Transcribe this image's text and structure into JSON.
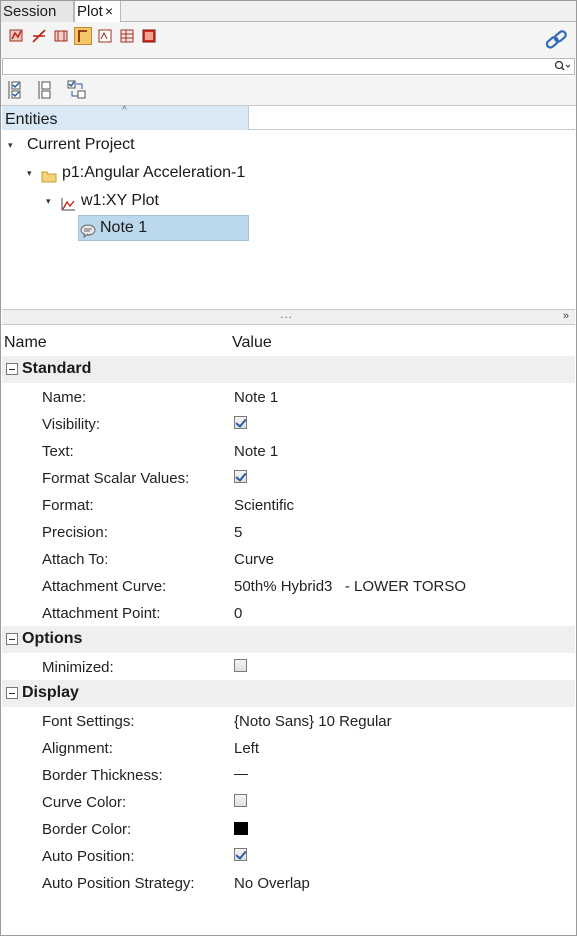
{
  "tabs": [
    {
      "label": "Session"
    },
    {
      "label": "Plot",
      "close": "×"
    }
  ],
  "search": {
    "value": "",
    "placeholder": ""
  },
  "tree": {
    "column_header": "Entities",
    "items": [
      {
        "label": "Current Project",
        "level": 0,
        "icon": "none"
      },
      {
        "label": "p1:Angular Acceleration-1",
        "level": 1,
        "icon": "folder-icon"
      },
      {
        "label": "w1:XY Plot",
        "level": 2,
        "icon": "xy-plot-icon"
      },
      {
        "label": "Note 1",
        "level": 3,
        "icon": "note-icon",
        "selected": true
      }
    ]
  },
  "splitter": {
    "dots": "...",
    "chevron": "»"
  },
  "properties": {
    "col_name": "Name",
    "col_value": "Value",
    "groups": {
      "standard": {
        "label": "Standard",
        "rows": {
          "name": {
            "label": "Name:",
            "value": "Note 1"
          },
          "visibility": {
            "label": "Visibility:",
            "checked": true
          },
          "text": {
            "label": "Text:",
            "value": "Note 1"
          },
          "format_scalar": {
            "label": "Format Scalar Values:",
            "checked": true
          },
          "format": {
            "label": "Format:",
            "value": "Scientific"
          },
          "precision": {
            "label": "Precision:",
            "value": "5"
          },
          "attach_to": {
            "label": "Attach To:",
            "value": "Curve"
          },
          "attachment_curve": {
            "label": "Attachment Curve:",
            "value": "50th% Hybrid3   - LOWER TORSO"
          },
          "attachment_point": {
            "label": "Attachment Point:",
            "value": "0"
          }
        }
      },
      "options": {
        "label": "Options",
        "rows": {
          "minimized": {
            "label": "Minimized:",
            "checked": false
          }
        }
      },
      "display": {
        "label": "Display",
        "rows": {
          "font_settings": {
            "label": "Font Settings:",
            "value": "{Noto Sans} 10 Regular"
          },
          "alignment": {
            "label": "Alignment:",
            "value": "Left"
          },
          "border_thickness": {
            "label": "Border Thickness:",
            "value": "line"
          },
          "curve_color": {
            "label": "Curve Color:",
            "checked": false
          },
          "border_color": {
            "label": "Border Color:",
            "color": "#000000"
          },
          "auto_position": {
            "label": "Auto Position:",
            "checked": true
          },
          "auto_position_strategy": {
            "label": "Auto Position Strategy:",
            "value": "No Overlap"
          }
        }
      }
    }
  },
  "colors": {
    "selection": "#bcd8ec",
    "header_accent": "#d8e8f4",
    "group_band": "#efefef"
  }
}
